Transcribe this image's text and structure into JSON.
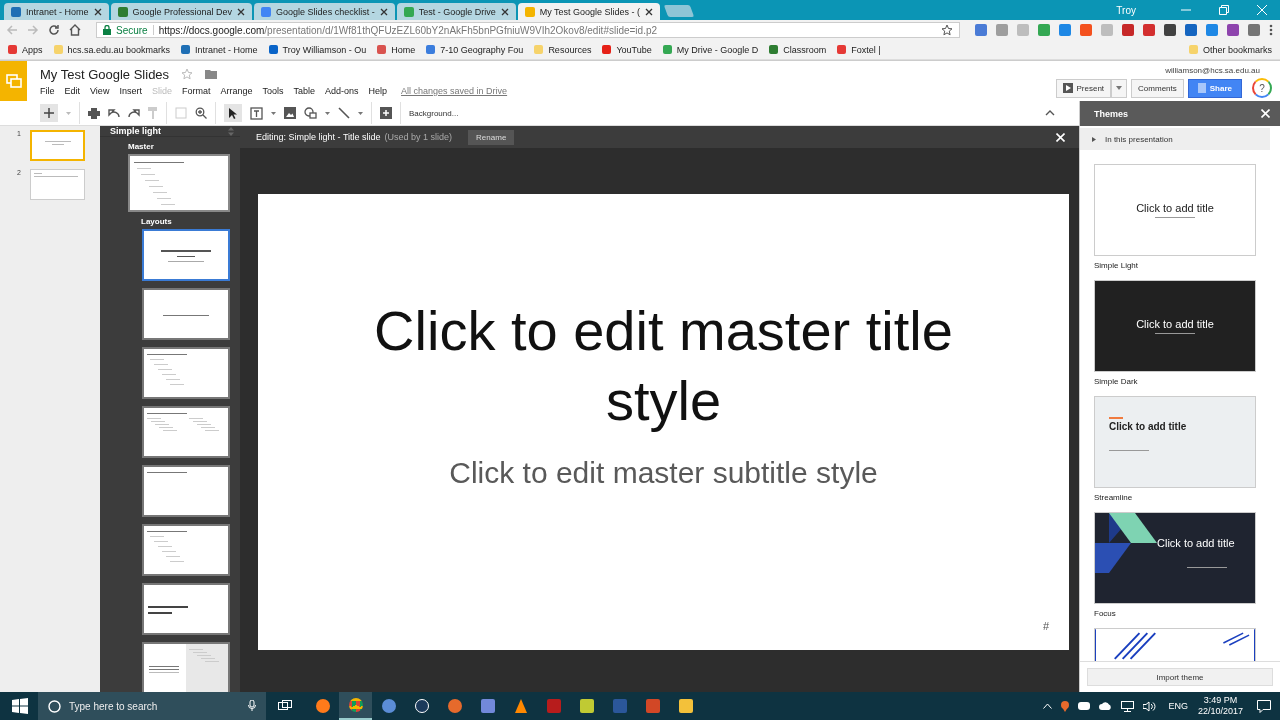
{
  "browser": {
    "tabs": [
      {
        "title": "Intranet - Home",
        "selected": false
      },
      {
        "title": "Google Professional Dev",
        "selected": false
      },
      {
        "title": "Google Slides checklist -",
        "selected": false
      },
      {
        "title": "Test - Google Drive",
        "selected": false
      },
      {
        "title": "My Test Google Slides - (",
        "selected": true
      }
    ],
    "profile": "Troy",
    "secure_label": "Secure",
    "url_host": "https://docs.google.com",
    "url_path": "/presentation/d/1Wf81thQFUzEZL60bY2nAkFh5bnPGfniuW9VIh2Okov8/edit#slide=id.p2",
    "bookmarks": [
      "Apps",
      "hcs.sa.edu.au bookmarks",
      "Intranet - Home",
      "Troy Williamson - Ou",
      "Home",
      "7-10 Geography Fou",
      "Resources",
      "YouTube",
      "My Drive - Google D",
      "Classroom",
      "Foxtel |"
    ],
    "other_bookmarks": "Other bookmarks"
  },
  "doc": {
    "title": "My Test Google Slides",
    "menu": [
      {
        "label": "File",
        "disabled": false
      },
      {
        "label": "Edit",
        "disabled": false
      },
      {
        "label": "View",
        "disabled": false
      },
      {
        "label": "Insert",
        "disabled": false
      },
      {
        "label": "Slide",
        "disabled": true
      },
      {
        "label": "Format",
        "disabled": false
      },
      {
        "label": "Arrange",
        "disabled": false
      },
      {
        "label": "Tools",
        "disabled": false
      },
      {
        "label": "Table",
        "disabled": false
      },
      {
        "label": "Add-ons",
        "disabled": false
      },
      {
        "label": "Help",
        "disabled": false
      }
    ],
    "save_status": "All changes saved in Drive",
    "account": "williamson@hcs.sa.edu.au",
    "present": "Present",
    "comments": "Comments",
    "share": "Share",
    "help": "?"
  },
  "toolbar": {
    "background": "Background..."
  },
  "filmstrip": [
    {
      "number": "1",
      "selected": true,
      "kind": "title"
    },
    {
      "number": "2",
      "selected": false,
      "kind": "body"
    }
  ],
  "master_panel": {
    "theme": "Simple light",
    "master_label": "Master",
    "layouts_label": "Layouts",
    "layouts": [
      {
        "kind": "title",
        "selected": true
      },
      {
        "kind": "section",
        "selected": false
      },
      {
        "kind": "body",
        "selected": false
      },
      {
        "kind": "two_columns",
        "selected": false
      },
      {
        "kind": "title_only",
        "selected": false
      },
      {
        "kind": "one_column",
        "selected": false
      },
      {
        "kind": "main_point",
        "selected": false
      },
      {
        "kind": "section_description",
        "selected": false
      }
    ]
  },
  "editor": {
    "heading": "Editing: Simple light - Title slide",
    "usage": "(Used by 1 slide)",
    "rename": "Rename",
    "slide_title": "Click to edit master title style",
    "slide_subtitle": "Click to edit master subtitle style",
    "slide_number": "#"
  },
  "themes": {
    "title": "Themes",
    "section": "In this presentation",
    "items": [
      {
        "name": "Simple Light",
        "kind": "light",
        "title": "Click to add title"
      },
      {
        "name": "Simple Dark",
        "kind": "dark",
        "title": "Click to add title"
      },
      {
        "name": "Streamline",
        "kind": "streamline",
        "title": "Click to add title"
      },
      {
        "name": "Focus",
        "kind": "focus",
        "title": "Click to add title"
      },
      {
        "kind": "stripes"
      }
    ],
    "import": "Import theme"
  },
  "taskbar": {
    "search_placeholder": "Type here to search",
    "language": "ENG",
    "time": "3:49 PM",
    "date": "22/10/2017"
  }
}
